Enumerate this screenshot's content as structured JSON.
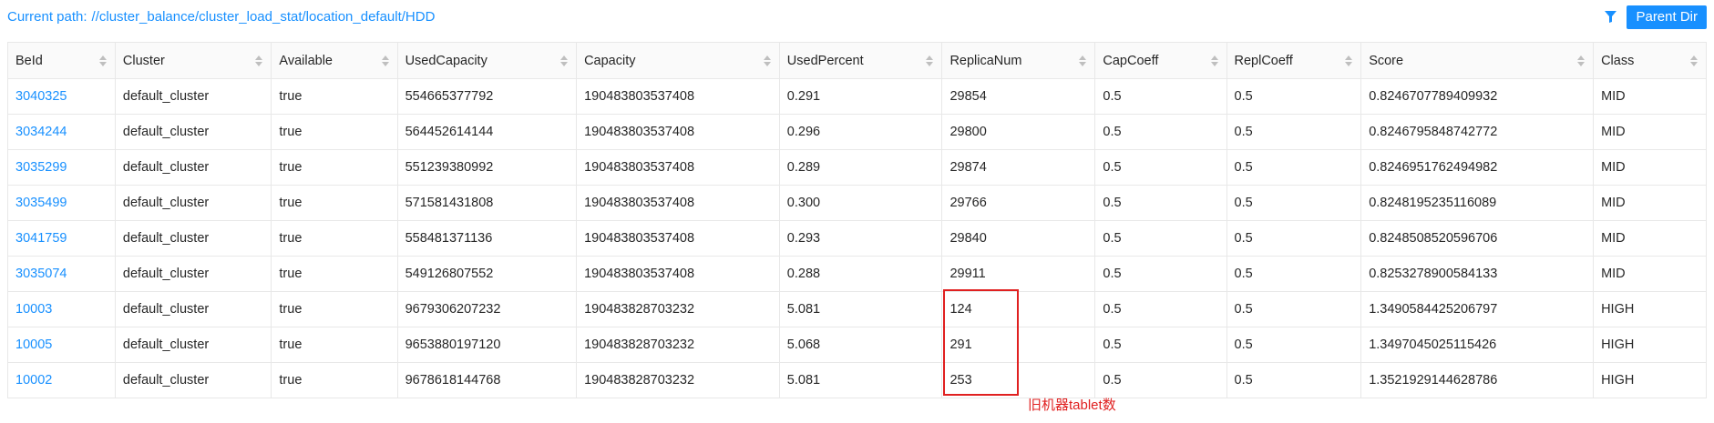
{
  "header": {
    "path_label": "Current path:",
    "path_value": "//cluster_balance/cluster_load_stat/location_default/HDD",
    "parent_dir_label": "Parent Dir"
  },
  "table": {
    "columns": [
      "BeId",
      "Cluster",
      "Available",
      "UsedCapacity",
      "Capacity",
      "UsedPercent",
      "ReplicaNum",
      "CapCoeff",
      "ReplCoeff",
      "Score",
      "Class"
    ],
    "rows": [
      [
        "3040325",
        "default_cluster",
        "true",
        "554665377792",
        "190483803537408",
        "0.291",
        "29854",
        "0.5",
        "0.5",
        "0.8246707789409932",
        "MID"
      ],
      [
        "3034244",
        "default_cluster",
        "true",
        "564452614144",
        "190483803537408",
        "0.296",
        "29800",
        "0.5",
        "0.5",
        "0.8246795848742772",
        "MID"
      ],
      [
        "3035299",
        "default_cluster",
        "true",
        "551239380992",
        "190483803537408",
        "0.289",
        "29874",
        "0.5",
        "0.5",
        "0.8246951762494982",
        "MID"
      ],
      [
        "3035499",
        "default_cluster",
        "true",
        "571581431808",
        "190483803537408",
        "0.300",
        "29766",
        "0.5",
        "0.5",
        "0.8248195235116089",
        "MID"
      ],
      [
        "3041759",
        "default_cluster",
        "true",
        "558481371136",
        "190483803537408",
        "0.293",
        "29840",
        "0.5",
        "0.5",
        "0.8248508520596706",
        "MID"
      ],
      [
        "3035074",
        "default_cluster",
        "true",
        "549126807552",
        "190483803537408",
        "0.288",
        "29911",
        "0.5",
        "0.5",
        "0.8253278900584133",
        "MID"
      ],
      [
        "10003",
        "default_cluster",
        "true",
        "9679306207232",
        "190483828703232",
        "5.081",
        "124",
        "0.5",
        "0.5",
        "1.3490584425206797",
        "HIGH"
      ],
      [
        "10005",
        "default_cluster",
        "true",
        "9653880197120",
        "190483828703232",
        "5.068",
        "291",
        "0.5",
        "0.5",
        "1.3497045025115426",
        "HIGH"
      ],
      [
        "10002",
        "default_cluster",
        "true",
        "9678618144768",
        "190483828703232",
        "5.081",
        "253",
        "0.5",
        "0.5",
        "1.3521929144628786",
        "HIGH"
      ]
    ]
  },
  "annotation": {
    "text": "旧机器tablet数",
    "color": "#e02020"
  },
  "colors": {
    "accent": "#1890ff",
    "annotation": "#e02020"
  },
  "icons": {
    "filter": "filter-icon",
    "sort": "sort-icon"
  }
}
